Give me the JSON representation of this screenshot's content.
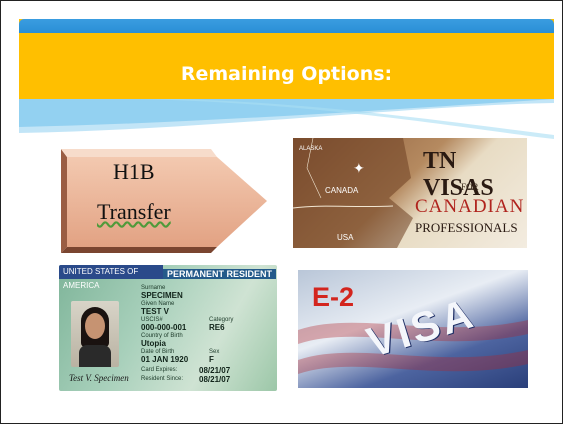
{
  "slide": {
    "title": "Remaining Options:",
    "accent_color": "#ffbf00",
    "header_color": "#2a8fd6"
  },
  "options": {
    "h1b": {
      "line1": "H1B",
      "line2": "Transfer"
    },
    "tn": {
      "title": "TN VISAS",
      "for": "FOR",
      "line1": "CANADIAN",
      "line2": "PROFESSIONALS",
      "map_canada": "CANADA",
      "map_usa": "USA",
      "map_alaska": "ALASKA"
    },
    "green_card": {
      "country": "UNITED STATES OF AMERICA",
      "type": "PERMANENT RESIDENT",
      "surname_label": "Surname",
      "surname": "SPECIMEN",
      "given_label": "Given Name",
      "given": "TEST V",
      "uscis_label": "USCIS#",
      "uscis": "000-000-001",
      "category_label": "Category",
      "category": "RE6",
      "birth_country_label": "Country of Birth",
      "birth_country": "Utopia",
      "dob_label": "Date of Birth",
      "dob": "01 JAN 1920",
      "sex_label": "Sex",
      "sex": "F",
      "expires_label": "Card Expires:",
      "expires": "08/21/07",
      "resident_label": "Resident Since:",
      "resident": "08/21/07",
      "signature": "Test V. Specimen"
    },
    "e2": {
      "label": "E-2",
      "visa": "VISA"
    }
  }
}
